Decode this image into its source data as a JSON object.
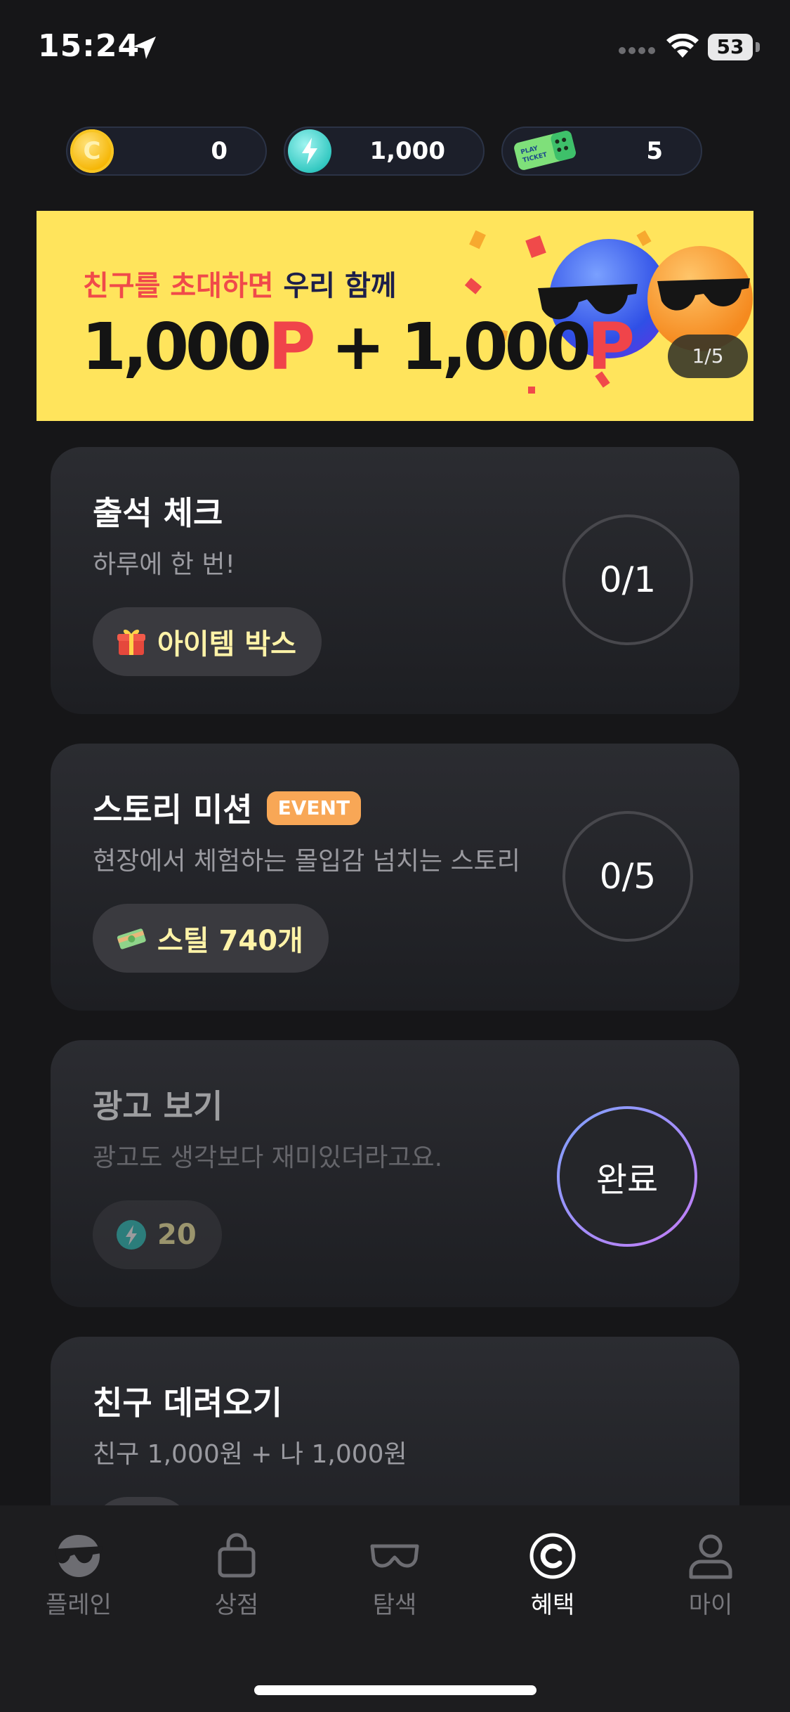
{
  "status_bar": {
    "time": "15:24",
    "battery": "53"
  },
  "currencies": [
    {
      "icon": "coin-icon",
      "value": "0"
    },
    {
      "icon": "energy-bolt-icon",
      "value": "1,000"
    },
    {
      "icon": "play-ticket-icon",
      "value": "5"
    }
  ],
  "banner": {
    "line1_a": "친구를 초대하면",
    "line1_b": "우리 함께",
    "amount_a": "1,000",
    "p_a": "P",
    "plus": " + ",
    "amount_b": "1,000",
    "p_b": "P",
    "counter": "1/5",
    "ticket_text": "PLAY TICKET"
  },
  "missions": [
    {
      "title": "출석 체크",
      "subtitle": "하루에 한 번!",
      "reward_icon": "gift-box-icon",
      "reward": "아이템 박스",
      "progress": "0/1"
    },
    {
      "title": "스토리 미션",
      "badge": "EVENT",
      "subtitle": "현장에서 체험하는 몰입감 넘치는 스토리",
      "reward_icon": "money-stack-icon",
      "reward": "스틸 740개",
      "progress": "0/5"
    },
    {
      "title": "광고 보기",
      "subtitle": "광고도 생각보다 재미있더라고요.",
      "reward_icon": "energy-bolt-icon",
      "reward": "20",
      "status": "완료"
    },
    {
      "title": "친구 데려오기",
      "subtitle": "친구 1,000원 + 나 1,000원"
    }
  ],
  "tabs": [
    {
      "icon": "player-face-icon",
      "label": "플레인"
    },
    {
      "icon": "shopping-bag-icon",
      "label": "상점"
    },
    {
      "icon": "vr-goggles-icon",
      "label": "탐색"
    },
    {
      "icon": "coin-c-icon",
      "label": "혜택",
      "active": true
    },
    {
      "icon": "person-icon",
      "label": "마이"
    }
  ],
  "colors": {
    "accent_yellow": "#ffe45c",
    "accent_red": "#f04a4a",
    "event_orange": "#f8a756",
    "reward_text": "#fff3a8"
  }
}
